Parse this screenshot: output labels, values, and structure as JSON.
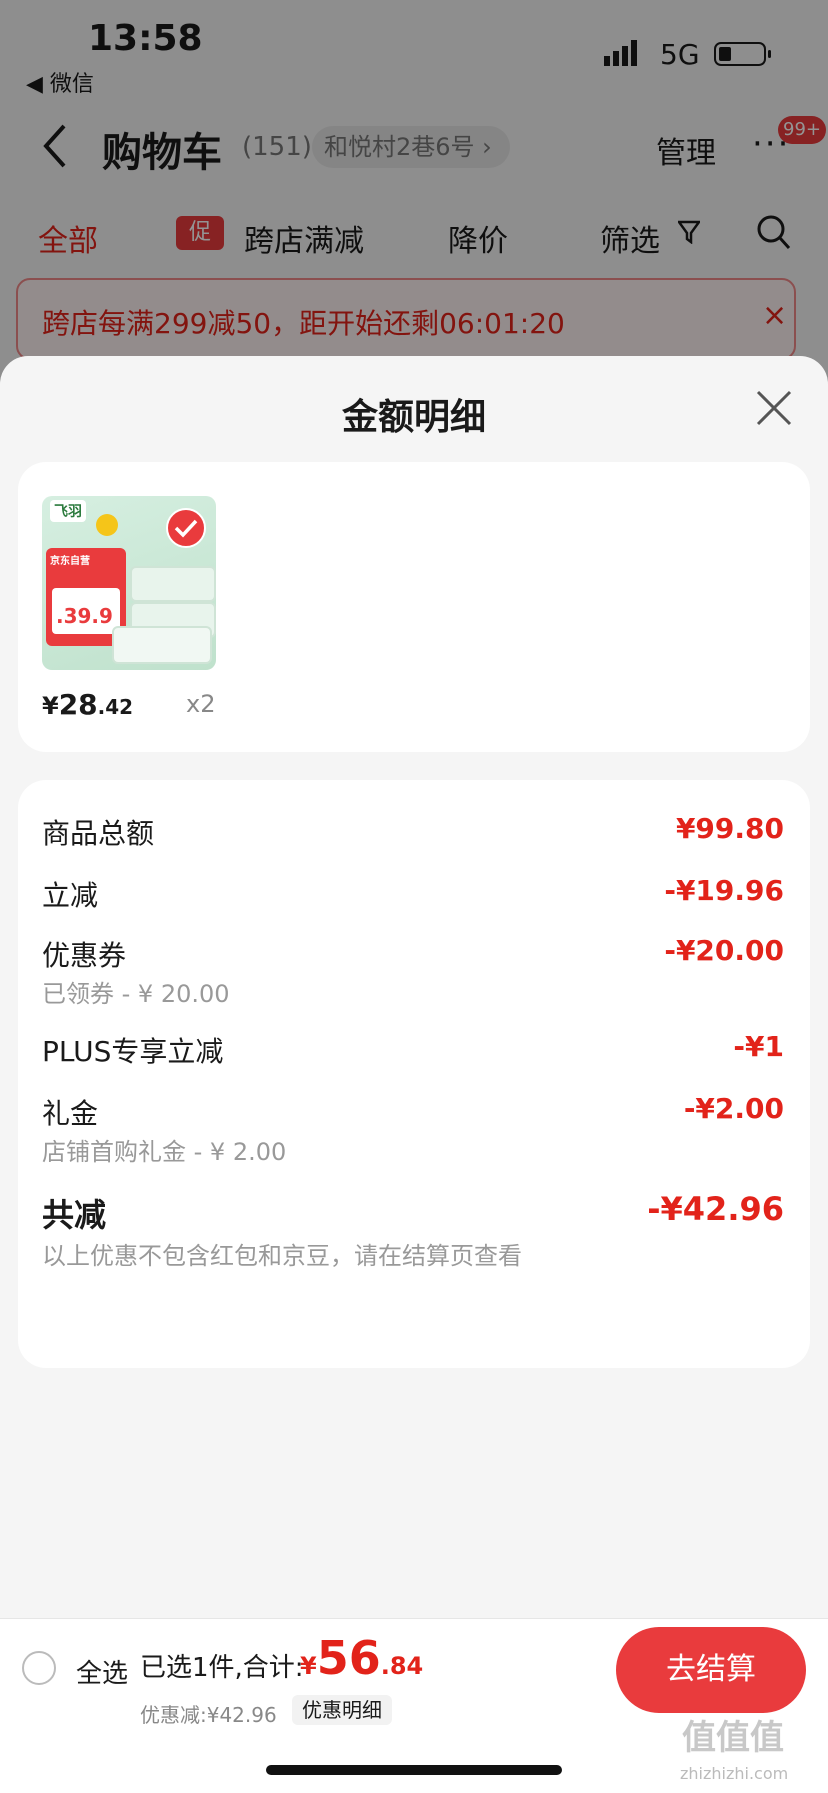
{
  "status_bar": {
    "time": "13:58",
    "back_app": "◀ 微信",
    "network": "5G"
  },
  "header": {
    "title": "购物车",
    "count": "(151)",
    "address": "和悦村2巷6号 ›",
    "manage": "管理",
    "more": "···",
    "badge": "99+"
  },
  "filters": {
    "all": "全部",
    "promo_tag": "促",
    "promo": "跨店满减",
    "price_drop": "降价",
    "screen": "筛选"
  },
  "promo_bar": {
    "text": "跨店每满299减50，距开始还剩06:01:20",
    "close": "×"
  },
  "sheet": {
    "title": "金额明细",
    "product": {
      "logo": "飞羽",
      "badge_top": "京东自营",
      "image_price": ".39.9",
      "price_symbol": "¥",
      "price_int": "28",
      "price_dec": ".42",
      "qty": "x2"
    },
    "details": [
      {
        "label": "商品总额",
        "value": "¥99.80",
        "sub": ""
      },
      {
        "label": "立减",
        "value": "-¥19.96",
        "sub": ""
      },
      {
        "label": "优惠券",
        "value": "-¥20.00",
        "sub": "已领券 - ¥ 20.00"
      },
      {
        "label": "PLUS专享立减",
        "value": "-¥1",
        "sub": ""
      },
      {
        "label": "礼金",
        "value": "-¥2.00",
        "sub": "店铺首购礼金 - ¥ 2.00"
      }
    ],
    "total": {
      "label": "共减",
      "value": "-¥42.96",
      "note": "以上优惠不包含红包和京豆，请在结算页查看"
    }
  },
  "bottom": {
    "select_all": "全选",
    "selected_info": "已选1件,合计:",
    "total_symbol": "¥",
    "total_int": "56",
    "total_dec": ".84",
    "discount": "优惠减:¥42.96",
    "discount_link": "优惠明细",
    "checkout": "去结算"
  },
  "watermark": {
    "text": "值值值",
    "sub": "zhizhizhi.com"
  },
  "colors": {
    "accent": "#e93b3d",
    "price_red": "#e2231a"
  }
}
